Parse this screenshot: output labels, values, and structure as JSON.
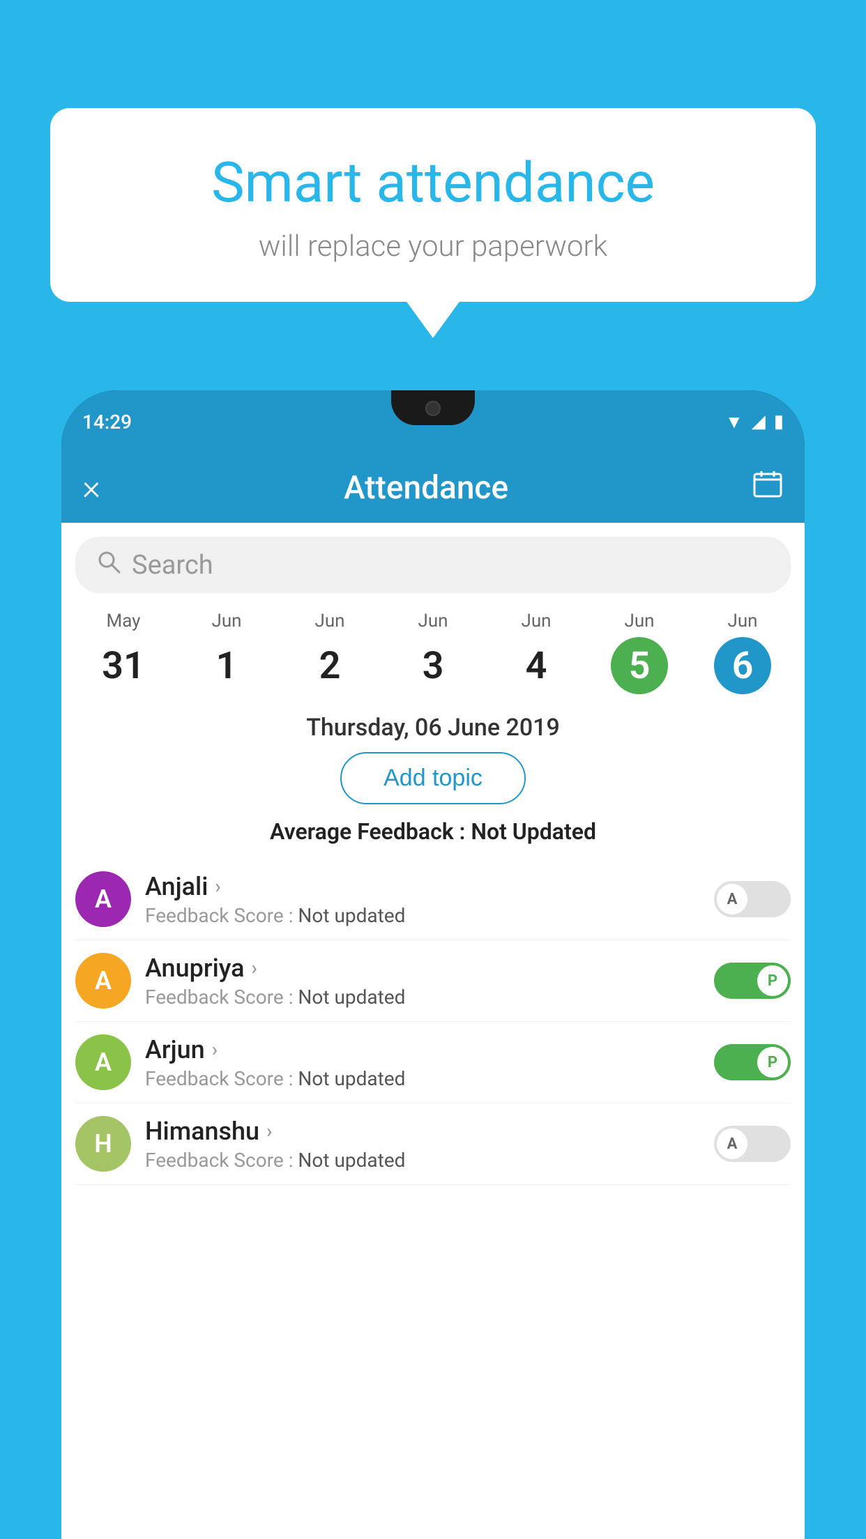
{
  "bubble": {
    "title": "Smart attendance",
    "subtitle": "will replace your paperwork"
  },
  "status_bar": {
    "time": "14:29",
    "icons": [
      "wifi",
      "signal",
      "battery"
    ]
  },
  "app_bar": {
    "title": "Attendance",
    "close_label": "×",
    "calendar_label": "📅"
  },
  "search": {
    "placeholder": "Search"
  },
  "dates": [
    {
      "month": "May",
      "day": "31",
      "state": "normal"
    },
    {
      "month": "Jun",
      "day": "1",
      "state": "normal"
    },
    {
      "month": "Jun",
      "day": "2",
      "state": "normal"
    },
    {
      "month": "Jun",
      "day": "3",
      "state": "normal"
    },
    {
      "month": "Jun",
      "day": "4",
      "state": "normal"
    },
    {
      "month": "Jun",
      "day": "5",
      "state": "today"
    },
    {
      "month": "Jun",
      "day": "6",
      "state": "selected"
    }
  ],
  "selected_date_label": "Thursday, 06 June 2019",
  "add_topic_label": "Add topic",
  "avg_feedback_label": "Average Feedback : ",
  "avg_feedback_value": "Not Updated",
  "students": [
    {
      "name": "Anjali",
      "avatar_letter": "A",
      "avatar_color": "#9c27b0",
      "feedback": "Feedback Score : ",
      "feedback_value": "Not updated",
      "toggle": "off",
      "toggle_label": "A"
    },
    {
      "name": "Anupriya",
      "avatar_letter": "A",
      "avatar_color": "#f5a623",
      "feedback": "Feedback Score : ",
      "feedback_value": "Not updated",
      "toggle": "on",
      "toggle_label": "P"
    },
    {
      "name": "Arjun",
      "avatar_letter": "A",
      "avatar_color": "#8bc34a",
      "feedback": "Feedback Score : ",
      "feedback_value": "Not updated",
      "toggle": "on",
      "toggle_label": "P"
    },
    {
      "name": "Himanshu",
      "avatar_letter": "H",
      "avatar_color": "#a5c465",
      "feedback": "Feedback Score : ",
      "feedback_value": "Not updated",
      "toggle": "off",
      "toggle_label": "A"
    }
  ]
}
